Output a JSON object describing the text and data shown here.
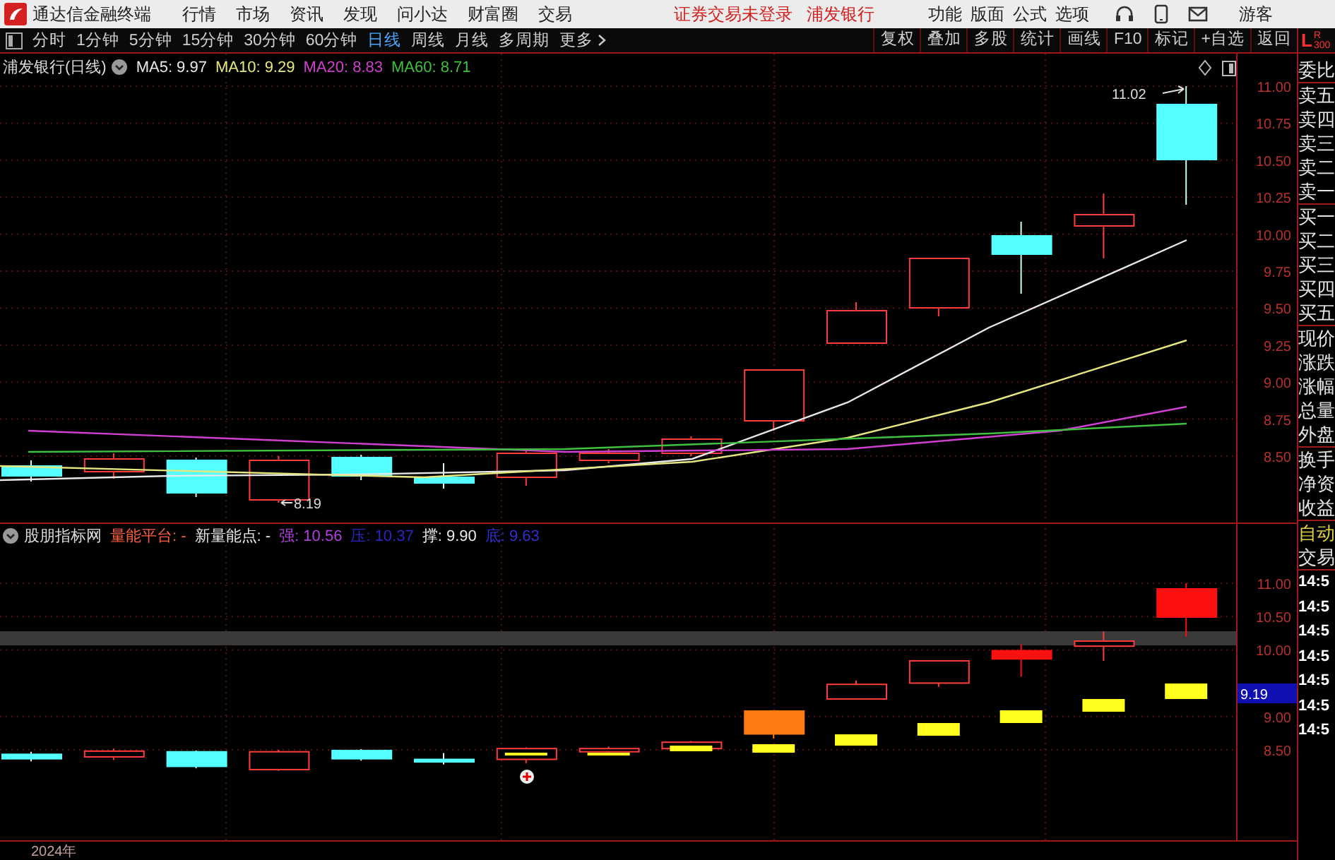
{
  "menu_bar": {
    "app_title": "通达信金融终端",
    "menus": [
      "行情",
      "市场",
      "资讯",
      "发现",
      "问小达",
      "财富圈",
      "交易"
    ],
    "notices": [
      "证券交易未登录",
      "浦发银行"
    ],
    "tools": [
      "功能",
      "版面",
      "公式",
      "选项"
    ],
    "user": "游客"
  },
  "toolbar": {
    "periods": [
      {
        "label": "分时",
        "selected": false
      },
      {
        "label": "1分钟",
        "selected": false
      },
      {
        "label": "5分钟",
        "selected": false
      },
      {
        "label": "15分钟",
        "selected": false
      },
      {
        "label": "30分钟",
        "selected": false
      },
      {
        "label": "60分钟",
        "selected": false
      },
      {
        "label": "日线",
        "selected": true
      },
      {
        "label": "周线",
        "selected": false
      },
      {
        "label": "月线",
        "selected": false
      },
      {
        "label": "多周期",
        "selected": false
      }
    ],
    "more": "更多",
    "tools": [
      "复权",
      "叠加",
      "多股",
      "统计",
      "画线",
      "F10",
      "标记",
      "+自选",
      "返回"
    ]
  },
  "price_panel": {
    "title": "浦发银行(日线)",
    "moving_averages": [
      {
        "label": "MA5: 9.97",
        "color": "#e8e8e8"
      },
      {
        "label": "MA10: 9.29",
        "color": "#e6e680"
      },
      {
        "label": "MA20: 8.83",
        "color": "#d040d0"
      },
      {
        "label": "MA60: 8.71",
        "color": "#40c040"
      }
    ],
    "axis_labels": [
      "11.00",
      "10.75",
      "10.50",
      "10.25",
      "10.00",
      "9.75",
      "9.50",
      "9.25",
      "9.00",
      "8.75",
      "8.50"
    ],
    "high_label": "11.02",
    "low_label": "8.19"
  },
  "indicator_panel": {
    "title": "股朋指标网",
    "fields": [
      {
        "label": "量能平台: -",
        "color": "#ff6040"
      },
      {
        "label": "新量能点: -",
        "color": "#e8e8e8"
      },
      {
        "label": "强: 10.56",
        "color": "#b040e0"
      },
      {
        "label": "压: 10.37",
        "color": "#2828c0"
      },
      {
        "label": "撑: 9.90",
        "color": "#e8e8e8"
      },
      {
        "label": "底: 9.63",
        "color": "#3030d0"
      }
    ],
    "axis_labels": [
      "11.00",
      "10.50",
      "10.00",
      "9.00",
      "8.50"
    ],
    "price_marker": "9.19"
  },
  "date_axis": {
    "label": "2024年"
  },
  "quote_panel": {
    "corner": {
      "left": "L",
      "right": "R",
      "sub": "300"
    },
    "groups": [
      [
        {
          "label": "委比",
          "highlighted": false
        }
      ],
      [
        {
          "label": "卖五",
          "highlighted": false
        },
        {
          "label": "卖四",
          "highlighted": false
        },
        {
          "label": "卖三",
          "highlighted": false
        },
        {
          "label": "卖二",
          "highlighted": false
        },
        {
          "label": "卖一",
          "highlighted": false
        }
      ],
      [
        {
          "label": "买一",
          "highlighted": false
        },
        {
          "label": "买二",
          "highlighted": false
        },
        {
          "label": "买三",
          "highlighted": false
        },
        {
          "label": "买四",
          "highlighted": false
        },
        {
          "label": "买五",
          "highlighted": false
        }
      ],
      [
        {
          "label": "现价",
          "highlighted": false
        },
        {
          "label": "涨跌",
          "highlighted": false
        },
        {
          "label": "涨幅",
          "highlighted": false
        },
        {
          "label": "总量",
          "highlighted": false
        },
        {
          "label": "外盘",
          "highlighted": false
        }
      ],
      [
        {
          "label": "换手",
          "highlighted": false
        },
        {
          "label": "净资",
          "highlighted": false
        },
        {
          "label": "收益",
          "highlighted": false
        }
      ],
      [
        {
          "label": "自动",
          "highlighted": true
        },
        {
          "label": "交易",
          "highlighted": false
        }
      ]
    ],
    "times": [
      "14:5",
      "14:5",
      "14:5",
      "14:5",
      "14:5",
      "14:5",
      "14:5"
    ]
  }
}
